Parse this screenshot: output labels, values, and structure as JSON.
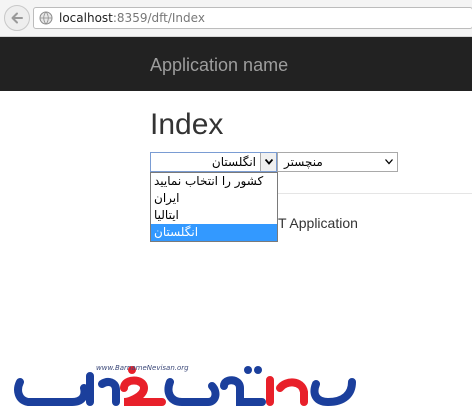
{
  "browser": {
    "url_host": "localhost",
    "url_rest": ":8359/dft/Index"
  },
  "navbar": {
    "brand": "Application name"
  },
  "page": {
    "title": "Index",
    "body_text": "T Application"
  },
  "country_select": {
    "selected": "انگلستان",
    "options": [
      "کشور را انتخاب نمایید",
      "ایران",
      "ایتالیا",
      "انگلستان"
    ],
    "highlighted_index": 3
  },
  "city_select": {
    "selected": "منچستر"
  },
  "logo": {
    "url": "www.BarnameNevisan.org",
    "text": "برنامه نویسان"
  },
  "colors": {
    "navbar": "#222222",
    "brand_text": "#9d9d9d",
    "highlight": "#3399ff",
    "logo_blue": "#1b3f9c",
    "logo_red": "#e8202a"
  },
  "icons": [
    "back-arrow-icon",
    "globe-icon",
    "chevron-down-icon"
  ]
}
